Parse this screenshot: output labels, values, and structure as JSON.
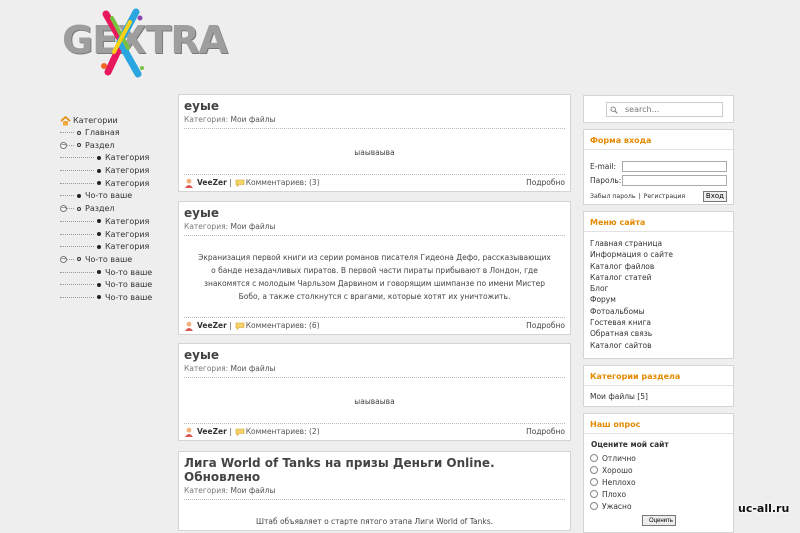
{
  "logo": {
    "text": "GEXTRA",
    "icon": "paint-splash-x-icon"
  },
  "tree": {
    "root": "Категории",
    "items": [
      {
        "label": "Главная",
        "level": 1,
        "bullet": "open"
      },
      {
        "label": "Раздел",
        "level": 1,
        "bullet": "open",
        "toggle": "−"
      },
      {
        "label": "Категория",
        "level": 2,
        "bullet": "filled"
      },
      {
        "label": "Категория",
        "level": 2,
        "bullet": "filled"
      },
      {
        "label": "Категория",
        "level": 2,
        "bullet": "filled"
      },
      {
        "label": "Чо-то ваше",
        "level": 1,
        "bullet": "filled"
      },
      {
        "label": "Раздел",
        "level": 1,
        "bullet": "open",
        "toggle": "−"
      },
      {
        "label": "Категория",
        "level": 2,
        "bullet": "filled"
      },
      {
        "label": "Категория",
        "level": 2,
        "bullet": "filled"
      },
      {
        "label": "Категория",
        "level": 2,
        "bullet": "filled"
      },
      {
        "label": "Чо-то ваше",
        "level": 1,
        "bullet": "open",
        "toggle": "−"
      },
      {
        "label": "Чо-то ваше",
        "level": 2,
        "bullet": "filled"
      },
      {
        "label": "Чо-то ваше",
        "level": 2,
        "bullet": "filled"
      },
      {
        "label": "Чо-то ваше",
        "level": 2,
        "bullet": "filled"
      }
    ]
  },
  "posts": [
    {
      "title": "еуые",
      "category_label": "Категория:",
      "category": "Мои файлы",
      "body": "ыаываыва",
      "author": "VeeZer",
      "comments": "Комментариев: (3)",
      "more": "Подробно"
    },
    {
      "title": "еуые",
      "category_label": "Категория:",
      "category": "Мои файлы",
      "body": "Экранизация первой книги из серии романов писателя Гидеона Дефо, рассказывающих о банде незадачливых пиратов. В первой части пираты прибывают в Лондон, где знакомятся с молодым Чарльзом Дарвином и говорящим шимпанзе по имени Мистер Бобо, а также столкнутся с врагами, которые хотят их уничтожить.",
      "author": "VeeZer",
      "comments": "Комментариев: (6)",
      "more": "Подробно"
    },
    {
      "title": "еуые",
      "category_label": "Категория:",
      "category": "Мои файлы",
      "body": "ыаываыва",
      "author": "VeeZer",
      "comments": "Комментариев: (2)",
      "more": "Подробно"
    },
    {
      "title": "Лига World of Tanks на призы Деньги Online. Обновлено",
      "category_label": "Категория:",
      "category": "Мои файлы",
      "body": "Штаб объявляет о старте пятого этапа Лиги World of Tanks."
    }
  ],
  "search": {
    "placeholder": "search..."
  },
  "login": {
    "title": "Форма входа",
    "email_label": "E-mail:",
    "password_label": "Пароль:",
    "forgot": "Забыл пароль",
    "divider": "|",
    "register": "Регистрация",
    "submit": "Вход"
  },
  "menu": {
    "title": "Меню сайта",
    "items": [
      "Главная страница",
      "Информация о сайте",
      "Каталог файлов",
      "Каталог статей",
      "Блог",
      "Форум",
      "Фотоальбомы",
      "Гостевая книга",
      "Обратная связь",
      "Каталог сайтов"
    ]
  },
  "categories": {
    "title": "Категории раздела",
    "item": "Мои файлы [5]"
  },
  "poll": {
    "title": "Наш опрос",
    "question": "Оцените мой сайт",
    "options": [
      "Отлично",
      "Хорошо",
      "Неплохо",
      "Плохо",
      "Ужасно"
    ],
    "vote_label": "Оценить"
  },
  "watermark": "uc-all.ru",
  "colors": {
    "accent": "#e28a00",
    "background": "#eeeeee",
    "panel": "#ffffff"
  }
}
